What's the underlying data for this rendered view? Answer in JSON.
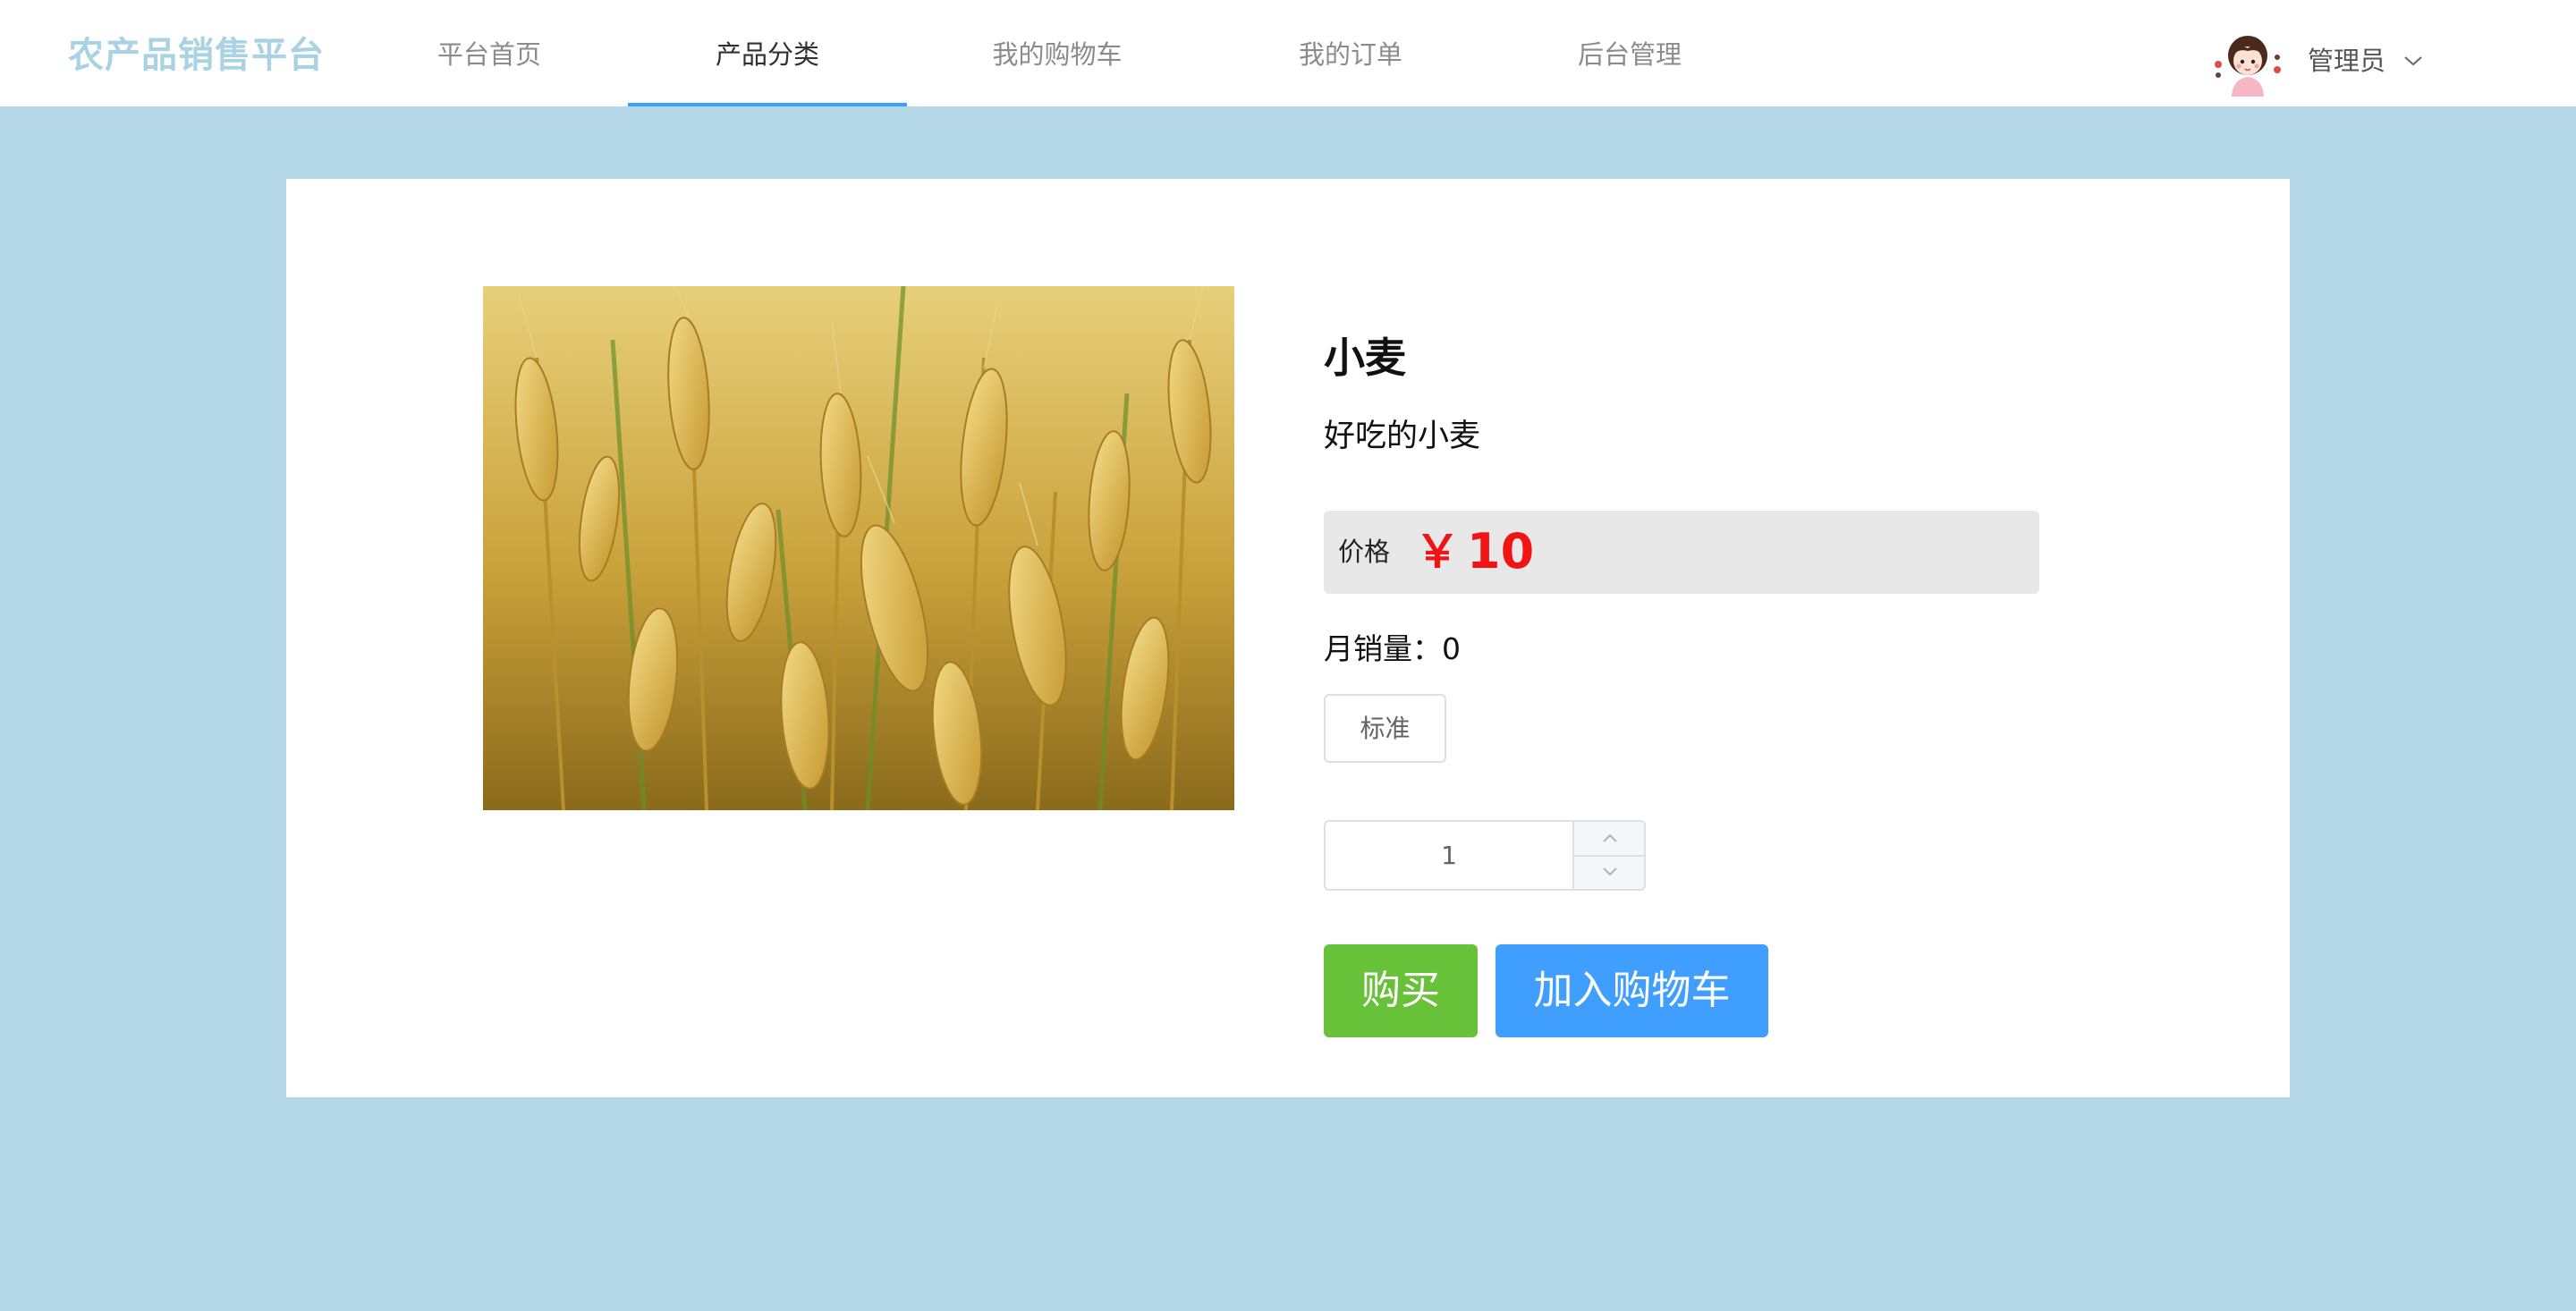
{
  "header": {
    "brand": "农产品销售平台",
    "nav": [
      {
        "label": "平台首页",
        "active": false
      },
      {
        "label": "产品分类",
        "active": true
      },
      {
        "label": "我的购物车",
        "active": false
      },
      {
        "label": "我的订单",
        "active": false
      },
      {
        "label": "后台管理",
        "active": false
      }
    ],
    "user": {
      "name": "管理员",
      "avatar_icon": "cartoon-girl-avatar",
      "caret_icon": "chevron-down-icon"
    }
  },
  "product": {
    "image_icon": "wheat-field-photo",
    "name": "小麦",
    "description": "好吃的小麦",
    "price_label": "价格",
    "currency": "￥",
    "price": "10",
    "sales_label": "月销量：",
    "sales": "0",
    "spec_option": "标准",
    "quantity": "1",
    "buy_label": "购买",
    "add_to_cart_label": "加入购物车"
  },
  "colors": {
    "page_bg": "#b4d8e8",
    "brand": "#a9d2e3",
    "nav_active_underline": "#409eff",
    "price": "#f01414",
    "buy_button": "#67c23a",
    "cart_button": "#409eff"
  }
}
